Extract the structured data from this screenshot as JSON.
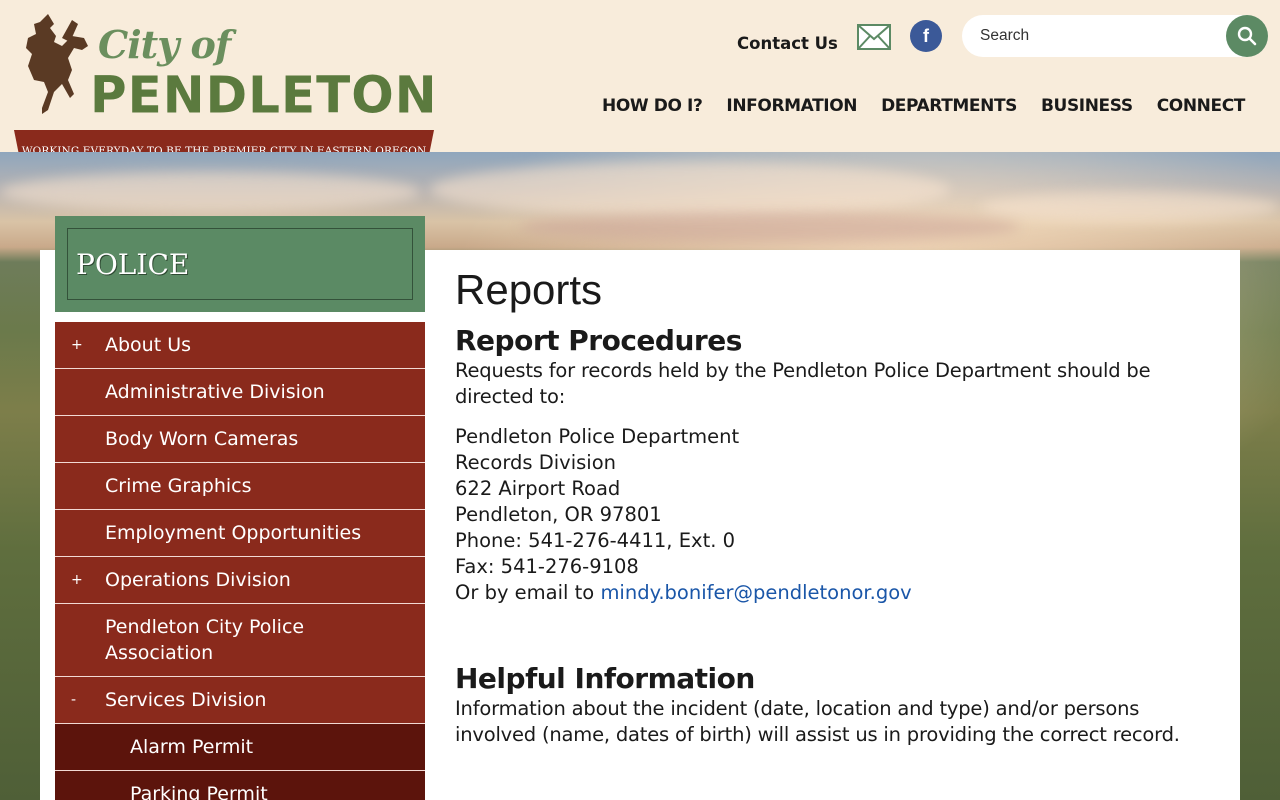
{
  "header": {
    "logo": {
      "city_of": "City of",
      "name": "PENDLETON"
    },
    "tagline": "WORKING EVERYDAY TO BE THE PREMIER CITY IN EASTERN OREGON",
    "contact_label": "Contact Us",
    "mail_icon": "mail-icon",
    "facebook_icon": "facebook-icon",
    "search": {
      "placeholder": "Search",
      "icon": "search-icon"
    },
    "nav": [
      "HOW DO I?",
      "INFORMATION",
      "DEPARTMENTS",
      "BUSINESS",
      "CONNECT"
    ]
  },
  "sidebar": {
    "section_title": "POLICE",
    "items": [
      {
        "sign": "+",
        "label": "About Us",
        "sub": false
      },
      {
        "sign": "",
        "label": "Administrative Division",
        "sub": false
      },
      {
        "sign": "",
        "label": "Body Worn Cameras",
        "sub": false
      },
      {
        "sign": "",
        "label": "Crime Graphics",
        "sub": false
      },
      {
        "sign": "",
        "label": "Employment Opportunities",
        "sub": false
      },
      {
        "sign": "+",
        "label": "Operations Division",
        "sub": false
      },
      {
        "sign": "",
        "label": "Pendleton City Police Association",
        "sub": false
      },
      {
        "sign": "-",
        "label": "Services Division",
        "sub": false
      },
      {
        "sign": "",
        "label": "Alarm Permit",
        "sub": true
      },
      {
        "sign": "",
        "label": "Parking Permit",
        "sub": true
      }
    ]
  },
  "main": {
    "title": "Reports",
    "section1": {
      "heading": "Report Procedures",
      "intro": "Requests for records held by the Pendleton Police Department should be directed to:",
      "address_lines": [
        "Pendleton Police Department",
        "Records Division",
        "622 Airport Road",
        "Pendleton, OR 97801",
        "Phone: 541-276-4411, Ext. 0",
        "Fax: 541-276-9108"
      ],
      "email_prefix": "Or by email to ",
      "email": "mindy.bonifer@pendletonor.gov"
    },
    "section2": {
      "heading": "Helpful Information",
      "text": "Information about the incident (date, location and type) and/or persons involved (name, dates of birth) will assist us in providing the correct record."
    }
  },
  "colors": {
    "banner": "#8a2a1c",
    "nav_item": "#8a2a1c",
    "nav_sub_item": "#5c140c",
    "section_box": "#5b8a64",
    "link": "#1a56a8",
    "search_button": "#5c8a64",
    "facebook": "#3b5998"
  }
}
